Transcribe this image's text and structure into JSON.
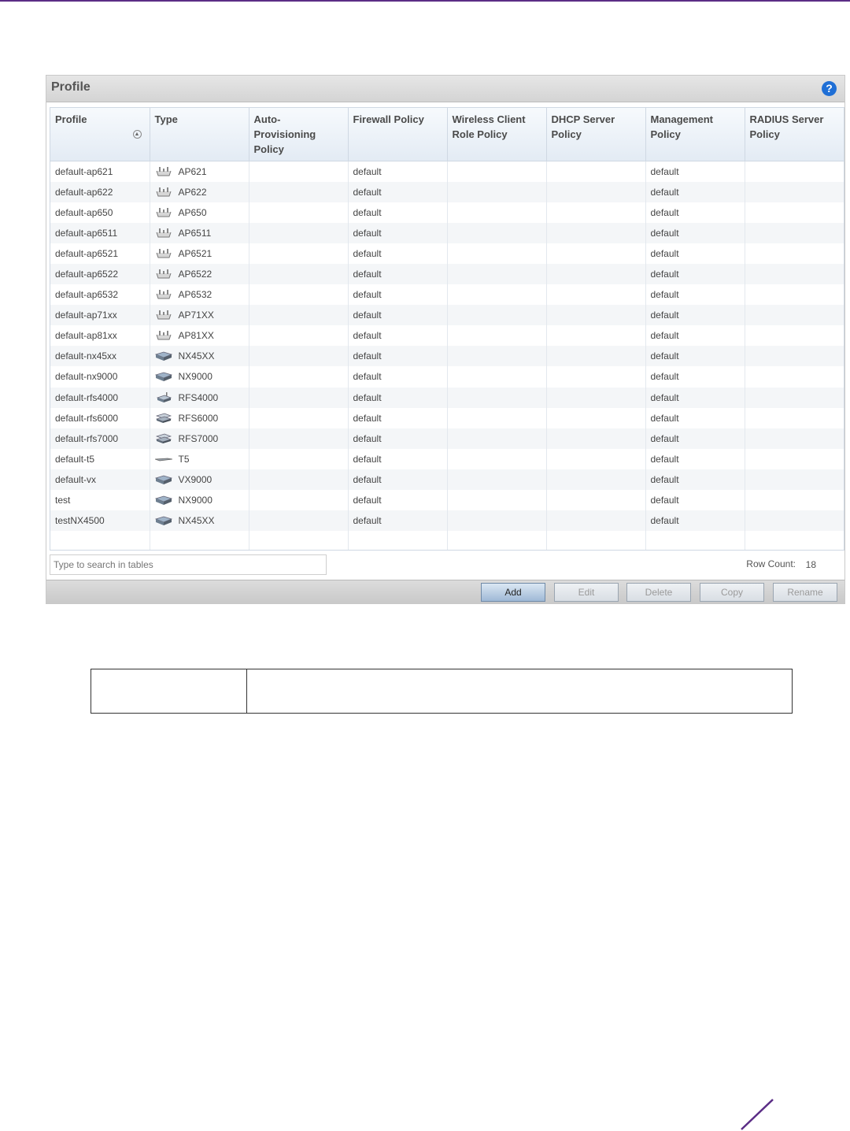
{
  "panel": {
    "title": "Profile",
    "help_icon": "?"
  },
  "table": {
    "columns": [
      "Profile",
      "Type",
      "Auto-\nProvisioning\nPolicy",
      "Firewall Policy",
      "Wireless Client\nRole Policy",
      "DHCP Server\nPolicy",
      "Management\nPolicy",
      "RADIUS Server\nPolicy"
    ],
    "rows": [
      {
        "profile": "default-ap621",
        "icon": "access-point",
        "type": "AP621",
        "auto": "",
        "firewall": "default",
        "wireless": "",
        "dhcp": "",
        "management": "default",
        "radius": ""
      },
      {
        "profile": "default-ap622",
        "icon": "access-point",
        "type": "AP622",
        "auto": "",
        "firewall": "default",
        "wireless": "",
        "dhcp": "",
        "management": "default",
        "radius": ""
      },
      {
        "profile": "default-ap650",
        "icon": "access-point",
        "type": "AP650",
        "auto": "",
        "firewall": "default",
        "wireless": "",
        "dhcp": "",
        "management": "default",
        "radius": ""
      },
      {
        "profile": "default-ap6511",
        "icon": "access-point",
        "type": "AP6511",
        "auto": "",
        "firewall": "default",
        "wireless": "",
        "dhcp": "",
        "management": "default",
        "radius": ""
      },
      {
        "profile": "default-ap6521",
        "icon": "access-point",
        "type": "AP6521",
        "auto": "",
        "firewall": "default",
        "wireless": "",
        "dhcp": "",
        "management": "default",
        "radius": ""
      },
      {
        "profile": "default-ap6522",
        "icon": "access-point",
        "type": "AP6522",
        "auto": "",
        "firewall": "default",
        "wireless": "",
        "dhcp": "",
        "management": "default",
        "radius": ""
      },
      {
        "profile": "default-ap6532",
        "icon": "access-point",
        "type": "AP6532",
        "auto": "",
        "firewall": "default",
        "wireless": "",
        "dhcp": "",
        "management": "default",
        "radius": ""
      },
      {
        "profile": "default-ap71xx",
        "icon": "access-point",
        "type": "AP71XX",
        "auto": "",
        "firewall": "default",
        "wireless": "",
        "dhcp": "",
        "management": "default",
        "radius": ""
      },
      {
        "profile": "default-ap81xx",
        "icon": "access-point",
        "type": "AP81XX",
        "auto": "",
        "firewall": "default",
        "wireless": "",
        "dhcp": "",
        "management": "default",
        "radius": ""
      },
      {
        "profile": "default-nx45xx",
        "icon": "appliance",
        "type": "NX45XX",
        "auto": "",
        "firewall": "default",
        "wireless": "",
        "dhcp": "",
        "management": "default",
        "radius": ""
      },
      {
        "profile": "default-nx9000",
        "icon": "appliance",
        "type": "NX9000",
        "auto": "",
        "firewall": "default",
        "wireless": "",
        "dhcp": "",
        "management": "default",
        "radius": ""
      },
      {
        "profile": "default-rfs4000",
        "icon": "controller-small",
        "type": "RFS4000",
        "auto": "",
        "firewall": "default",
        "wireless": "",
        "dhcp": "",
        "management": "default",
        "radius": ""
      },
      {
        "profile": "default-rfs6000",
        "icon": "controller",
        "type": "RFS6000",
        "auto": "",
        "firewall": "default",
        "wireless": "",
        "dhcp": "",
        "management": "default",
        "radius": ""
      },
      {
        "profile": "default-rfs7000",
        "icon": "controller",
        "type": "RFS7000",
        "auto": "",
        "firewall": "default",
        "wireless": "",
        "dhcp": "",
        "management": "default",
        "radius": ""
      },
      {
        "profile": "default-t5",
        "icon": "flat-device",
        "type": "T5",
        "auto": "",
        "firewall": "default",
        "wireless": "",
        "dhcp": "",
        "management": "default",
        "radius": ""
      },
      {
        "profile": "default-vx",
        "icon": "appliance",
        "type": "VX9000",
        "auto": "",
        "firewall": "default",
        "wireless": "",
        "dhcp": "",
        "management": "default",
        "radius": ""
      },
      {
        "profile": "test",
        "icon": "appliance",
        "type": "NX9000",
        "auto": "",
        "firewall": "default",
        "wireless": "",
        "dhcp": "",
        "management": "default",
        "radius": ""
      },
      {
        "profile": "testNX4500",
        "icon": "appliance",
        "type": "NX45XX",
        "auto": "",
        "firewall": "default",
        "wireless": "",
        "dhcp": "",
        "management": "default",
        "radius": ""
      }
    ]
  },
  "search": {
    "placeholder": "Type to search in tables"
  },
  "row_count": {
    "label": "Row Count:",
    "value": "18"
  },
  "buttons": {
    "add": "Add",
    "edit": "Edit",
    "delete": "Delete",
    "copy": "Copy",
    "rename": "Rename"
  }
}
